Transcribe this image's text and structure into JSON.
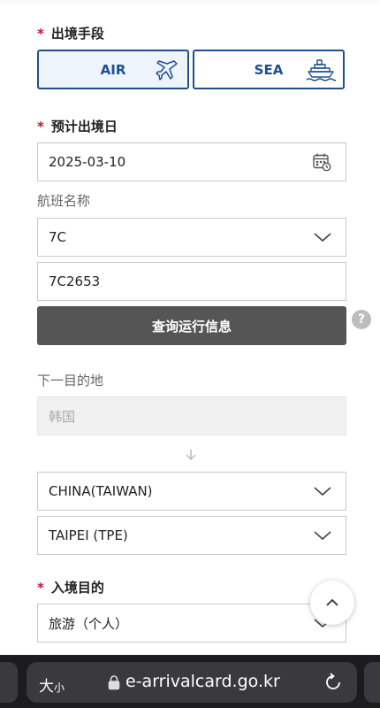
{
  "exit_method": {
    "label": "出境手段",
    "options": [
      {
        "label": "AIR",
        "icon": "airplane-icon",
        "selected": true
      },
      {
        "label": "SEA",
        "icon": "ship-icon",
        "selected": false
      }
    ]
  },
  "exit_date": {
    "label": "预计出境日",
    "value": "2025-03-10",
    "icon": "calendar-icon"
  },
  "flight": {
    "label": "航班名称",
    "airline_value": "7C",
    "flight_number_value": "7C2653",
    "query_button": "查询运行信息",
    "help_icon": "?"
  },
  "next_destination": {
    "label": "下一目的地",
    "origin_value": "韩国",
    "country_value": "CHINA(TAIWAN)",
    "city_value": "TAIPEI (TPE)"
  },
  "entry_purpose": {
    "label": "入境目的",
    "value": "旅游（个人）"
  },
  "required_mark": "*",
  "browser": {
    "text_size_label": "大",
    "text_size_small": "小",
    "url": "e-arrivalcard.go.kr"
  },
  "colors": {
    "accent": "#1f4f8f",
    "required": "#c8102e",
    "query_button_bg": "#555555"
  }
}
